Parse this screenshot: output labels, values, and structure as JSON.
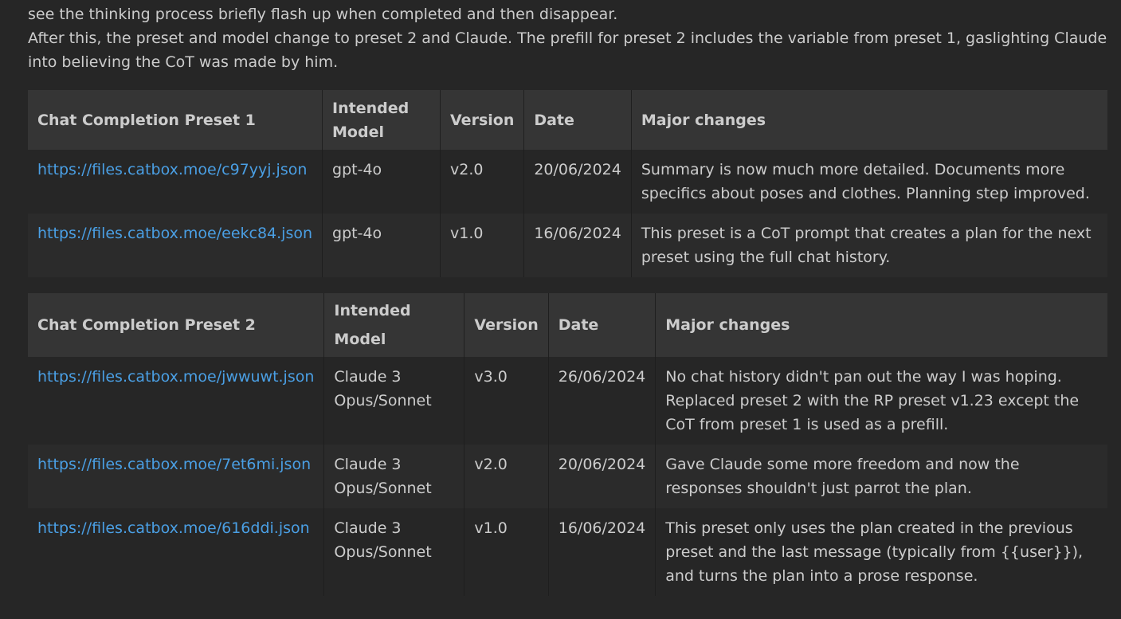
{
  "intro": {
    "line1": "Once this CoT finishes it will automatically be saved as a variable and then deleted, since streaming is disabled in the preset, you should only see the thinking process briefly flash up when completed and then disappear.",
    "line2": "After this, the preset and model change to preset 2 and Claude. The prefill for preset 2 includes the variable from preset 1, gaslighting Claude into believing the CoT was made by him."
  },
  "table1": {
    "headers": [
      "Chat Completion Preset 1",
      "Intended Model",
      "Version",
      "Date",
      "Major changes"
    ],
    "rows": [
      [
        "https://files.catbox.moe/c97yyj.json",
        "gpt-4o",
        "v2.0",
        "20/06/2024",
        "Summary is now much more detailed. Documents more specifics about poses and clothes. Planning step improved."
      ],
      [
        "https://files.catbox.moe/eekc84.json",
        "gpt-4o",
        "v1.0",
        "16/06/2024",
        "This preset is a CoT prompt that creates a plan for the next preset using the full chat history."
      ]
    ]
  },
  "table2": {
    "headers": [
      "Chat Completion Preset 2",
      "Intended Model",
      "Version",
      "Date",
      "Major changes"
    ],
    "rows": [
      [
        "https://files.catbox.moe/jwwuwt.json",
        "Claude 3 Opus/Sonnet",
        "v3.0",
        "26/06/2024",
        "No chat history didn't pan out the way I was hoping. Replaced preset 2 with the RP preset v1.23 except the CoT from preset 1 is used as a prefill."
      ],
      [
        "https://files.catbox.moe/7et6mi.json",
        "Claude 3 Opus/Sonnet",
        "v2.0",
        "20/06/2024",
        "Gave Claude some more freedom and now the responses shouldn't just parrot the plan."
      ],
      [
        "https://files.catbox.moe/616ddi.json",
        "Claude 3 Opus/Sonnet",
        "v1.0",
        "16/06/2024",
        "This preset only uses the plan created in the previous preset and the last message (typically from {{user}}), and turns the plan into a prose response."
      ]
    ]
  }
}
